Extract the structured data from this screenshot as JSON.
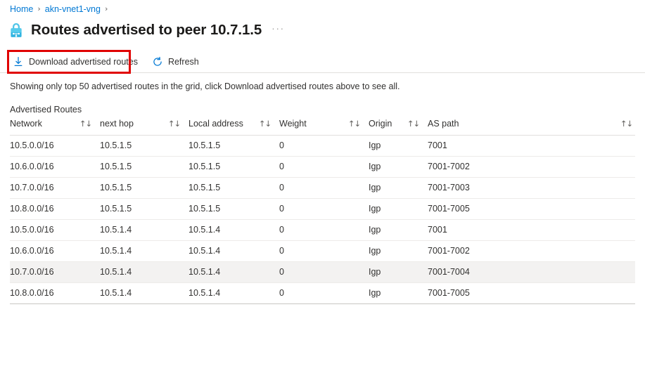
{
  "breadcrumb": {
    "items": [
      {
        "label": "Home"
      },
      {
        "label": "akn-vnet1-vng"
      }
    ],
    "separator": "›"
  },
  "header": {
    "icon": "vpn-gateway-padlock-icon",
    "title": "Routes advertised to peer 10.7.1.5",
    "more_menu": "···"
  },
  "toolbar": {
    "download_label": "Download advertised routes",
    "download_icon": "download-icon",
    "refresh_label": "Refresh",
    "refresh_icon": "refresh-icon",
    "highlight_color": "#e00000",
    "accent_color": "#0078d4"
  },
  "notice": {
    "text": "Showing only top 50 advertised routes in the grid, click Download advertised routes above to see all."
  },
  "grid": {
    "label": "Advertised Routes",
    "sort_glyph": "↑↓",
    "columns": [
      {
        "key": "network",
        "label": "Network"
      },
      {
        "key": "next_hop",
        "label": "next hop"
      },
      {
        "key": "local_address",
        "label": "Local address"
      },
      {
        "key": "weight",
        "label": "Weight"
      },
      {
        "key": "origin",
        "label": "Origin"
      },
      {
        "key": "as_path",
        "label": "AS path"
      }
    ],
    "rows": [
      {
        "network": "10.5.0.0/16",
        "next_hop": "10.5.1.5",
        "local_address": "10.5.1.5",
        "weight": "0",
        "origin": "Igp",
        "as_path": "7001",
        "hovered": false
      },
      {
        "network": "10.6.0.0/16",
        "next_hop": "10.5.1.5",
        "local_address": "10.5.1.5",
        "weight": "0",
        "origin": "Igp",
        "as_path": "7001-7002",
        "hovered": false
      },
      {
        "network": "10.7.0.0/16",
        "next_hop": "10.5.1.5",
        "local_address": "10.5.1.5",
        "weight": "0",
        "origin": "Igp",
        "as_path": "7001-7003",
        "hovered": false
      },
      {
        "network": "10.8.0.0/16",
        "next_hop": "10.5.1.5",
        "local_address": "10.5.1.5",
        "weight": "0",
        "origin": "Igp",
        "as_path": "7001-7005",
        "hovered": false
      },
      {
        "network": "10.5.0.0/16",
        "next_hop": "10.5.1.4",
        "local_address": "10.5.1.4",
        "weight": "0",
        "origin": "Igp",
        "as_path": "7001",
        "hovered": false
      },
      {
        "network": "10.6.0.0/16",
        "next_hop": "10.5.1.4",
        "local_address": "10.5.1.4",
        "weight": "0",
        "origin": "Igp",
        "as_path": "7001-7002",
        "hovered": false
      },
      {
        "network": "10.7.0.0/16",
        "next_hop": "10.5.1.4",
        "local_address": "10.5.1.4",
        "weight": "0",
        "origin": "Igp",
        "as_path": "7001-7004",
        "hovered": true
      },
      {
        "network": "10.8.0.0/16",
        "next_hop": "10.5.1.4",
        "local_address": "10.5.1.4",
        "weight": "0",
        "origin": "Igp",
        "as_path": "7001-7005",
        "hovered": false
      }
    ]
  }
}
